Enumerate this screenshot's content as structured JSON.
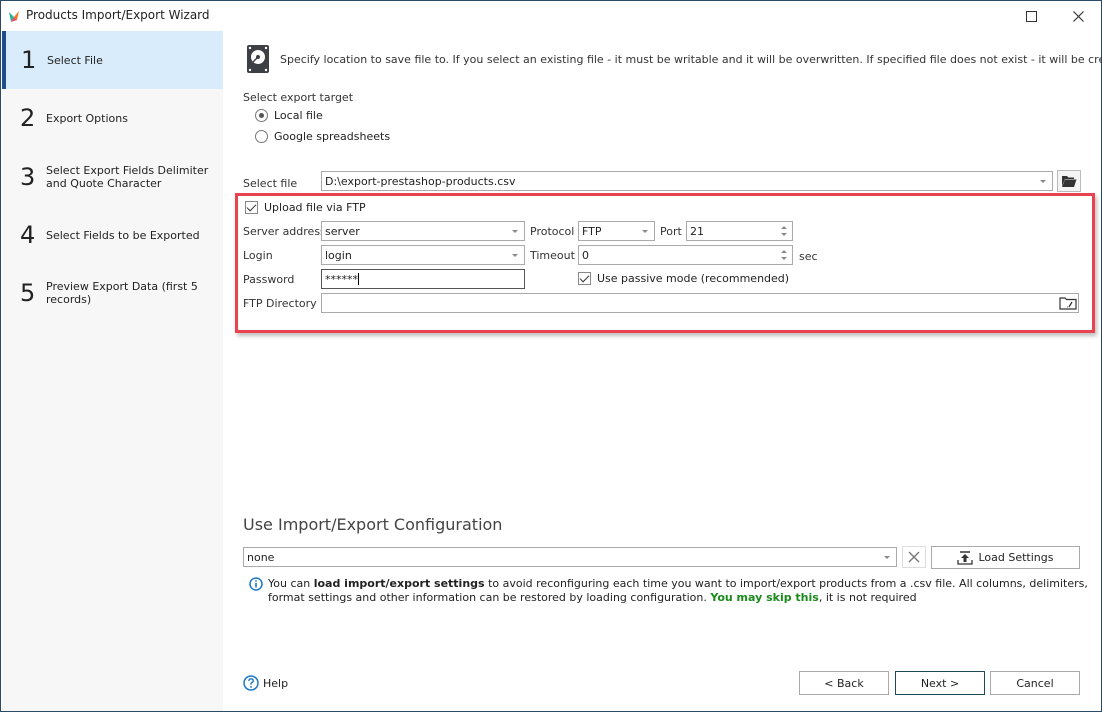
{
  "window": {
    "title": "Products Import/Export Wizard",
    "controls": {
      "maximize": "maximize",
      "close": "close"
    }
  },
  "sidebar": {
    "steps": [
      {
        "num": "1",
        "label": "Select File",
        "active": true
      },
      {
        "num": "2",
        "label": "Export Options",
        "active": false
      },
      {
        "num": "3",
        "label": "Select Export Fields Delimiter and Quote Character",
        "active": false
      },
      {
        "num": "4",
        "label": "Select Fields to be Exported",
        "active": false
      },
      {
        "num": "5",
        "label": "Preview Export Data (first 5 records)",
        "active": false
      }
    ]
  },
  "main": {
    "hint": "Specify location to save file to. If you select an existing file - it must be writable and it will be overwritten. If specified file does not exist - it will be created.",
    "export_target": {
      "label": "Select export target",
      "options": [
        {
          "label": "Local file",
          "selected": true
        },
        {
          "label": "Google spreadsheets",
          "selected": false
        }
      ]
    },
    "select_file": {
      "label": "Select file",
      "value": "D:\\export-prestashop-products.csv"
    },
    "ftp": {
      "upload_label": "Upload file via FTP",
      "upload_checked": true,
      "server_label": "Server address",
      "server_value": "server",
      "protocol_label": "Protocol",
      "protocol_value": "FTP",
      "port_label": "Port",
      "port_value": "21",
      "login_label": "Login",
      "login_value": "login",
      "timeout_label": "Timeout",
      "timeout_value": "0",
      "timeout_unit": "sec",
      "password_label": "Password",
      "password_value": "******",
      "passive_label": "Use passive mode (recommended)",
      "passive_checked": true,
      "directory_label": "FTP Directory",
      "directory_value": ""
    },
    "configuration": {
      "title": "Use Import/Export Configuration",
      "value": "none",
      "load_button": "Load Settings",
      "info_prefix": "You can ",
      "info_bold": "load import/export settings",
      "info_mid": " to avoid reconfiguring each time you want to import/export products from a .csv file. All columns, delimiters, format settings and other information can be restored by loading configuration. ",
      "info_green": "You may skip this",
      "info_suffix": ", it is not required"
    }
  },
  "footer": {
    "help": "Help",
    "back": "< Back",
    "next": "Next >",
    "cancel": "Cancel"
  },
  "colors": {
    "highlight_frame": "#e8434f",
    "active_step_bg": "#d9ecfb",
    "active_step_bar": "#1f4f8a",
    "skip_green": "#1a8a1a"
  }
}
